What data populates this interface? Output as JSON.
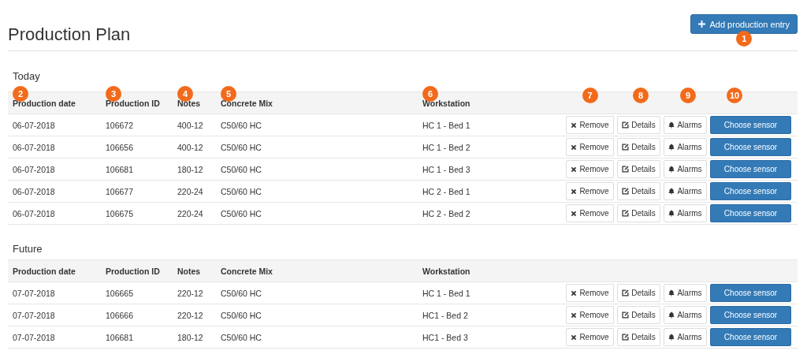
{
  "title": "Production Plan",
  "add_button": {
    "label": "Add production entry",
    "callout": "1"
  },
  "sections": [
    {
      "title": "Today",
      "columns": [
        {
          "label": "Production date",
          "callout": "2"
        },
        {
          "label": "Production ID",
          "callout": "3"
        },
        {
          "label": "Notes",
          "callout": "4"
        },
        {
          "label": "Concrete Mix",
          "callout": "5"
        },
        {
          "label": "Workstation",
          "callout": "6"
        }
      ],
      "action_callouts": [
        "7",
        "8",
        "9",
        "10"
      ],
      "rows": [
        {
          "cells": [
            "06-07-2018",
            "106672",
            "400-12",
            "C50/60 HC",
            "HC 1 - Bed 1"
          ],
          "actions": [
            {
              "kind": "remove",
              "label": "Remove"
            },
            {
              "kind": "details",
              "label": "Details"
            },
            {
              "kind": "alarms",
              "label": "Alarms"
            },
            {
              "kind": "primary",
              "label": "Choose sensor"
            }
          ]
        },
        {
          "cells": [
            "06-07-2018",
            "106656",
            "400-12",
            "C50/60 HC",
            "HC 1 - Bed 2"
          ],
          "actions": [
            {
              "kind": "remove",
              "label": "Remove"
            },
            {
              "kind": "details",
              "label": "Details"
            },
            {
              "kind": "alarms",
              "label": "Alarms"
            },
            {
              "kind": "primary",
              "label": "Choose sensor"
            }
          ]
        },
        {
          "cells": [
            "06-07-2018",
            "106681",
            "180-12",
            "C50/60 HC",
            "HC 1 - Bed 3"
          ],
          "actions": [
            {
              "kind": "remove",
              "label": "Remove"
            },
            {
              "kind": "details",
              "label": "Details"
            },
            {
              "kind": "alarms",
              "label": "Alarms"
            },
            {
              "kind": "primary",
              "label": "Choose sensor"
            }
          ]
        },
        {
          "cells": [
            "06-07-2018",
            "106677",
            "220-24",
            "C50/60 HC",
            "HC 2 - Bed 1"
          ],
          "actions": [
            {
              "kind": "remove",
              "label": "Remove"
            },
            {
              "kind": "details",
              "label": "Details"
            },
            {
              "kind": "alarms",
              "label": "Alarms"
            },
            {
              "kind": "primary",
              "label": "Choose sensor"
            }
          ]
        },
        {
          "cells": [
            "06-07-2018",
            "106675",
            "220-24",
            "C50/60 HC",
            "HC 2 - Bed 2"
          ],
          "actions": [
            {
              "kind": "remove",
              "label": "Remove"
            },
            {
              "kind": "details",
              "label": "Details"
            },
            {
              "kind": "alarms",
              "label": "Alarms"
            },
            {
              "kind": "primary",
              "label": "Choose sensor"
            }
          ]
        }
      ]
    },
    {
      "title": "Future",
      "columns": [
        {
          "label": "Production date"
        },
        {
          "label": "Production ID"
        },
        {
          "label": "Notes"
        },
        {
          "label": "Concrete Mix"
        },
        {
          "label": "Workstation"
        }
      ],
      "rows": [
        {
          "cells": [
            "07-07-2018",
            "106665",
            "220-12",
            "C50/60 HC",
            "HC 1 - Bed 1"
          ],
          "actions": [
            {
              "kind": "remove",
              "label": "Remove"
            },
            {
              "kind": "details",
              "label": "Details"
            },
            {
              "kind": "alarms",
              "label": "Alarms"
            },
            {
              "kind": "primary",
              "label": "Choose sensor"
            }
          ]
        },
        {
          "cells": [
            "07-07-2018",
            "106666",
            "220-12",
            "C50/60 HC",
            "HC1 - Bed 2"
          ],
          "actions": [
            {
              "kind": "remove",
              "label": "Remove"
            },
            {
              "kind": "details",
              "label": "Details"
            },
            {
              "kind": "alarms",
              "label": "Alarms"
            },
            {
              "kind": "primary",
              "label": "Choose sensor"
            }
          ]
        },
        {
          "cells": [
            "07-07-2018",
            "106681",
            "180-12",
            "C50/60 HC",
            "HC1 - Bed 3"
          ],
          "actions": [
            {
              "kind": "remove",
              "label": "Remove"
            },
            {
              "kind": "details",
              "label": "Details"
            },
            {
              "kind": "alarms",
              "label": "Alarms"
            },
            {
              "kind": "primary",
              "label": "Choose sensor"
            }
          ]
        }
      ]
    }
  ]
}
